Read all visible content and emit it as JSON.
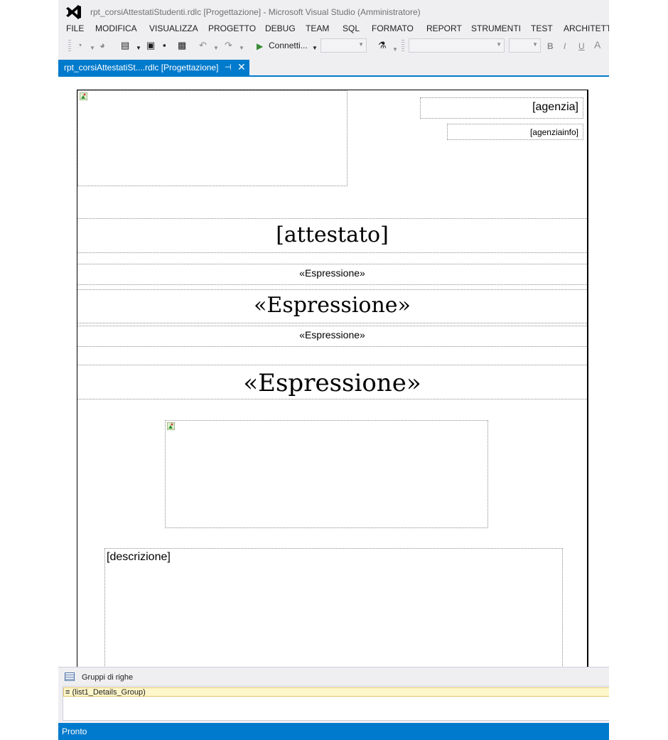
{
  "window": {
    "title": "rpt_corsiAttestatiStudenti.rdlc [Progettazione] - Microsoft Visual Studio (Amministratore)"
  },
  "menu": [
    "FILE",
    "MODIFICA",
    "VISUALIZZA",
    "PROGETTO",
    "DEBUG",
    "TEAM",
    "SQL",
    "FORMATO",
    "REPORT",
    "STRUMENTI",
    "TEST",
    "ARCHITETTU"
  ],
  "toolbar": {
    "run_label": "Connetti...",
    "bold": "B",
    "italic": "I",
    "underline": "U",
    "font_color": "A"
  },
  "tab": {
    "label": "rpt_corsiAttestatiSt....rdlc [Progettazione]",
    "pin": "⊣",
    "close": "✕"
  },
  "report": {
    "agenzia": "[agenzia]",
    "agenziainfo": "[agenziainfo]",
    "attestato": "[attestato]",
    "expr1": "«Espressione»",
    "expr2": "«Espressione»",
    "expr3": "«Espressione»",
    "expr4": "«Espressione»",
    "descrizione": "[descrizione]"
  },
  "groups": {
    "header": "Gruppi di righe",
    "row": "≡ (list1_Details_Group)"
  },
  "status": {
    "text": "Pronto"
  },
  "colors": {
    "accent": "#007acc",
    "run_green": "#388a34",
    "chrome": "#efeff2"
  }
}
